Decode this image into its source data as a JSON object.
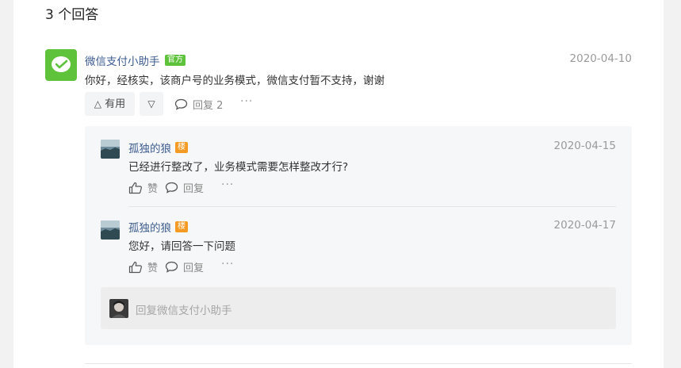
{
  "answers_count_label": "3 个回答",
  "answer": {
    "author": "微信支付小助手",
    "badge": "官方",
    "date": "2020-04-10",
    "content": "你好，经核实，该商户号的业务模式，微信支付暂不支持，谢谢",
    "useful_label": "有用",
    "reply_label": "回复 2",
    "more_label": "···"
  },
  "comments": [
    {
      "author": "孤独的狼",
      "badge": "楼",
      "date": "2020-04-15",
      "content": "已经进行整改了，业务模式需要怎样整改才行?",
      "like_label": "赞",
      "reply_label": "回复",
      "more_label": "···"
    },
    {
      "author": "孤独的狼",
      "badge": "楼",
      "date": "2020-04-17",
      "content": "您好，请回答一下问题",
      "like_label": "赞",
      "reply_label": "回复",
      "more_label": "···"
    }
  ],
  "reply_input": {
    "placeholder": "回复微信支付小助手"
  },
  "colors": {
    "brand_green": "#5ec23a",
    "link_blue": "#3d5c8f",
    "badge_orange": "#f59a23"
  },
  "icons": [
    "wechat-pay-logo-icon",
    "upvote-icon",
    "downvote-icon",
    "comment-icon",
    "thumbs-up-icon",
    "more-icon"
  ]
}
